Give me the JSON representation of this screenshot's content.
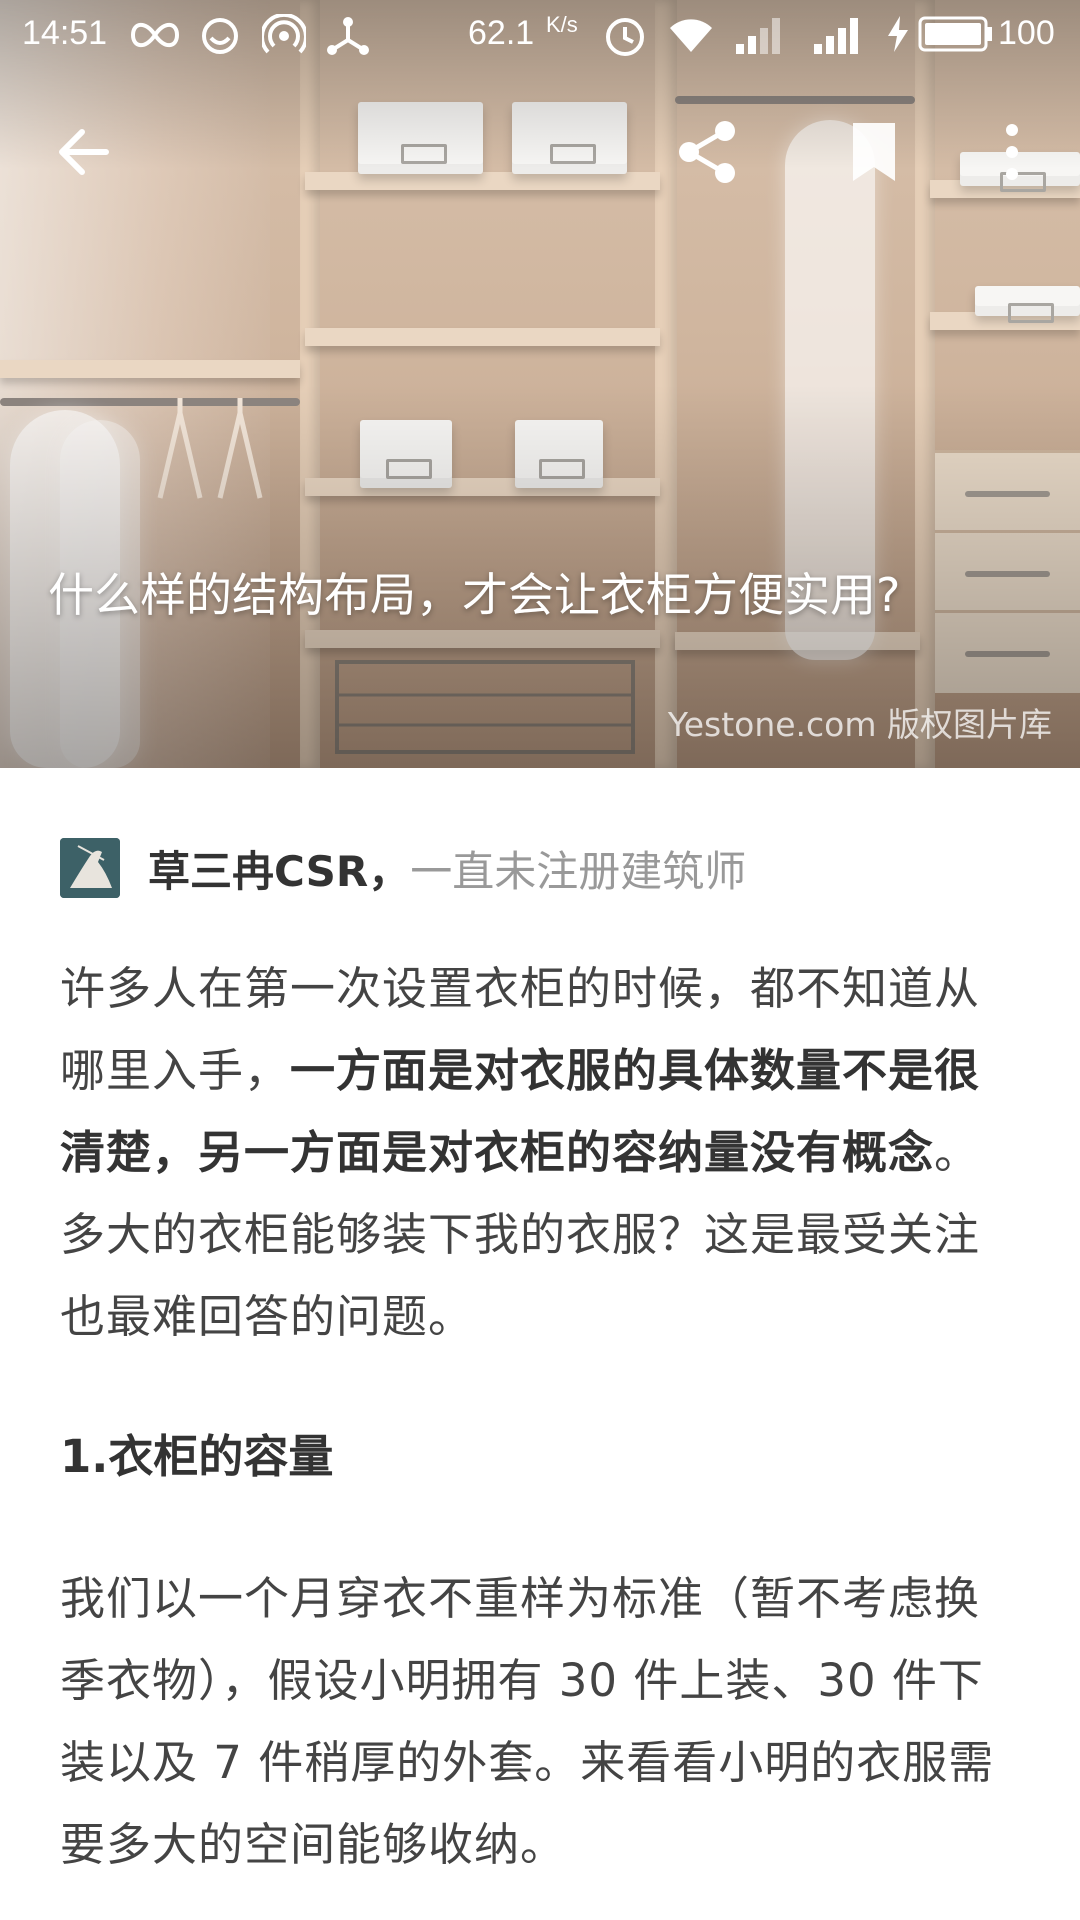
{
  "status_bar": {
    "time": "14:51",
    "net_speed": "62.1",
    "net_unit": "K/s",
    "battery": "100"
  },
  "toolbar": {
    "back_icon": "arrow-left-icon",
    "share_icon": "share-icon",
    "bookmark_icon": "bookmark-icon",
    "more_icon": "more-vertical-icon"
  },
  "hero": {
    "title": "什么样的结构布局，才会让衣柜方便实用?",
    "watermark": "Yestone.com 版权图片库"
  },
  "author": {
    "name": "草三冉CSR，",
    "bio": "一直未注册建筑师"
  },
  "article": {
    "p1_a": "许多人在第一次设置衣柜的时候，都不知道从哪里入手，",
    "p1_bold": "一方面是对衣服的具体数量不是很清楚，另一方面是对衣柜的容纳量没有概念",
    "p1_b": "。多大的衣柜能够装下我的衣服？这是最受关注也最难回答的问题。",
    "heading1": "1.衣柜的容量",
    "p2": "我们以一个月穿衣不重样为标准（暂不考虑换季衣物），假设小明拥有 30 件上装、30 件下装以及 7 件稍厚的外套。来看看小明的衣服需要多大的空间能够收纳。"
  },
  "colors": {
    "text_primary": "#333333",
    "text_body": "#444444",
    "text_muted": "#999999",
    "background": "#ffffff"
  }
}
